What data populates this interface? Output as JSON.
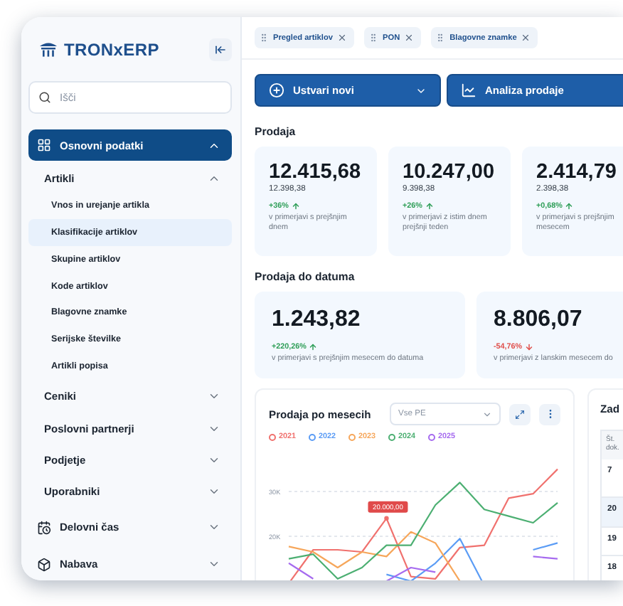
{
  "sidebar": {
    "logo": "TRONxERP",
    "search": {
      "placeholder": "Išči"
    },
    "nav": [
      {
        "label": "Osnovni podatki",
        "expanded": true,
        "selected": true,
        "children": [
          {
            "label": "Artikli",
            "expanded": true,
            "children": [
              {
                "label": "Vnos in urejanje artikla",
                "selected": false
              },
              {
                "label": "Klasifikacije artiklov",
                "selected": true
              },
              {
                "label": "Skupine artiklov",
                "selected": false
              },
              {
                "label": "Kode artiklov",
                "selected": false
              },
              {
                "label": "Blagovne znamke",
                "selected": false
              },
              {
                "label": "Serijske številke",
                "selected": false
              },
              {
                "label": "Artikli popisa",
                "selected": false
              }
            ]
          },
          {
            "label": "Ceniki",
            "expanded": false
          },
          {
            "label": "Poslovni partnerji",
            "expanded": false
          },
          {
            "label": "Podjetje",
            "expanded": false
          },
          {
            "label": "Uporabniki",
            "expanded": false
          }
        ]
      },
      {
        "label": "Delovni čas",
        "expanded": false,
        "selected": false
      },
      {
        "label": "Nabava",
        "expanded": false,
        "selected": false
      }
    ]
  },
  "tabs": [
    {
      "label": "Pregled artiklov"
    },
    {
      "label": "PON"
    },
    {
      "label": "Blagovne znamke"
    }
  ],
  "actions": [
    {
      "label": "Ustvari novi",
      "dropdown": true
    },
    {
      "label": "Analiza prodaje"
    }
  ],
  "sections": [
    {
      "title": "Prodaja",
      "kind": "compact",
      "cards": [
        {
          "value": "12.415,68",
          "previous": "12.398,38",
          "change": "+36%",
          "kind": "up",
          "note": "v primerjavi s prejšnjim dnem"
        },
        {
          "value": "10.247,00",
          "previous": "9.398,38",
          "change": "+26%",
          "kind": "up",
          "note": "v primerjavi z istim dnem prejšnji teden"
        },
        {
          "value": "2.414,79",
          "previous": "2.398,38",
          "change": "+0,68%",
          "kind": "up",
          "note": "v primerjavi s prejšnjim mesecem"
        }
      ]
    },
    {
      "title": "Prodaja do datuma",
      "kind": "wide",
      "cards": [
        {
          "value": "1.243,82",
          "change": "+220,26%",
          "kind": "up",
          "note": "v primerjavi s prejšnjim mesecem do datuma"
        },
        {
          "value": "8.806,07",
          "change": "-54,76%",
          "kind": "down",
          "note": "v primerjavi z lanskim mesecem do"
        }
      ]
    }
  ],
  "chart_panel": {
    "title": "Prodaja po mesecih",
    "filter": "Vse PE",
    "tooltip": "20.000,00",
    "axis_labels": [
      "30K",
      "20K"
    ],
    "legend": [
      {
        "name": "2021",
        "color": "#f0716e"
      },
      {
        "name": "2022",
        "color": "#5b9cf5"
      },
      {
        "name": "2023",
        "color": "#f6a65a"
      },
      {
        "name": "2024",
        "color": "#4caf72"
      },
      {
        "name": "2025",
        "color": "#a66bef"
      }
    ]
  },
  "table_panel": {
    "title": "Zad",
    "columns": [
      "Št. dok."
    ],
    "rows": [
      {
        "cells": [
          "7"
        ],
        "selected": false
      },
      {
        "cells": [
          "20"
        ],
        "selected": true
      },
      {
        "cells": [
          "19"
        ],
        "selected": false
      },
      {
        "cells": [
          "18"
        ],
        "selected": false
      }
    ]
  }
}
